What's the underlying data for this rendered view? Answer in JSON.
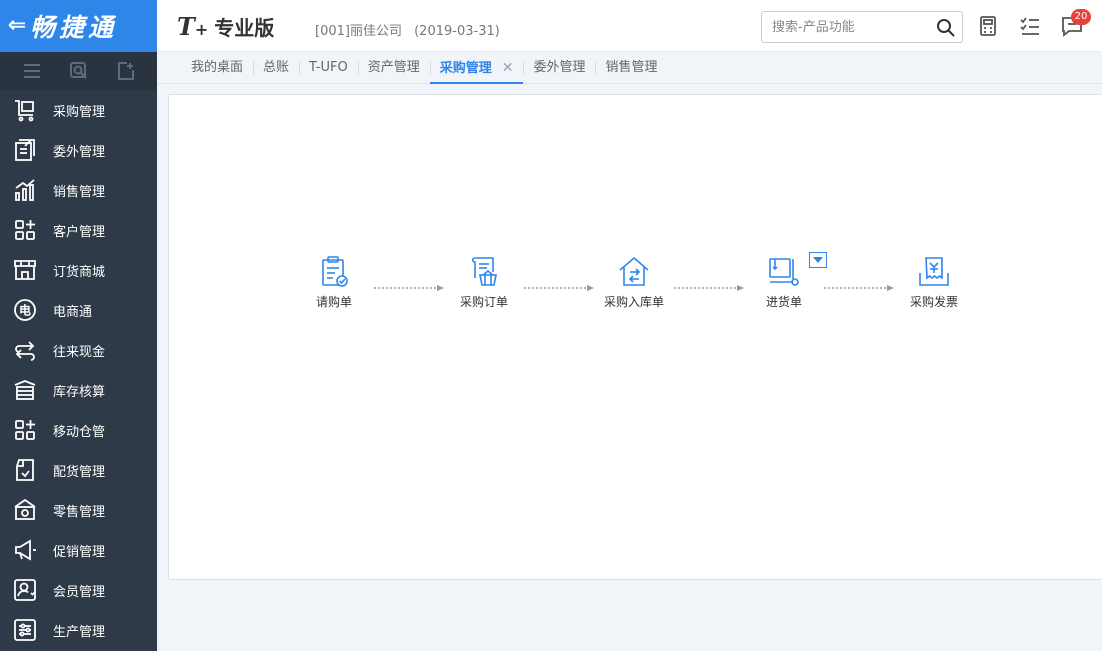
{
  "brand": {
    "back_glyph": "⇐",
    "name": "畅捷通"
  },
  "sidebar": {
    "tools": [
      {
        "icon": "menu-icon"
      },
      {
        "icon": "search-doc-icon"
      },
      {
        "icon": "add-doc-icon"
      }
    ],
    "items": [
      {
        "label": "采购管理",
        "icon": "cart-icon"
      },
      {
        "label": "委外管理",
        "icon": "outsource-icon"
      },
      {
        "label": "销售管理",
        "icon": "chart-icon"
      },
      {
        "label": "客户管理",
        "icon": "grid-plus-icon"
      },
      {
        "label": "订货商城",
        "icon": "store-icon"
      },
      {
        "label": "电商通",
        "icon": "ecommerce-icon"
      },
      {
        "label": "往来现金",
        "icon": "exchange-icon"
      },
      {
        "label": "库存核算",
        "icon": "inventory-icon"
      },
      {
        "label": "移动仓管",
        "icon": "grid-plus-icon"
      },
      {
        "label": "配货管理",
        "icon": "distribution-icon"
      },
      {
        "label": "零售管理",
        "icon": "retail-icon"
      },
      {
        "label": "促销管理",
        "icon": "megaphone-icon"
      },
      {
        "label": "会员管理",
        "icon": "member-icon"
      },
      {
        "label": "生产管理",
        "icon": "production-icon"
      }
    ]
  },
  "header": {
    "logo_t": "T",
    "logo_plus": "+",
    "edition": "专业版",
    "company": "[001]丽佳公司",
    "date": "(2019-03-31)",
    "search_placeholder": "搜索-产品功能",
    "notification_count": "20"
  },
  "tabs": [
    {
      "label": "我的桌面",
      "active": false
    },
    {
      "label": "总账",
      "active": false
    },
    {
      "label": "T-UFO",
      "active": false
    },
    {
      "label": "资产管理",
      "active": false
    },
    {
      "label": "采购管理",
      "active": true,
      "close": "✕"
    },
    {
      "label": "委外管理",
      "active": false
    },
    {
      "label": "销售管理",
      "active": false
    }
  ],
  "flow": {
    "nodes": [
      {
        "label": "请购单",
        "icon": "requisition-icon"
      },
      {
        "label": "采购订单",
        "icon": "purchase-order-icon"
      },
      {
        "label": "采购入库单",
        "icon": "warehouse-in-icon"
      },
      {
        "label": "进货单",
        "icon": "receipt-icon"
      },
      {
        "label": "采购发票",
        "icon": "invoice-icon"
      }
    ]
  },
  "colors": {
    "accent": "#2e86e8",
    "sidebar": "#2f3a48",
    "badge": "#e8413b"
  }
}
